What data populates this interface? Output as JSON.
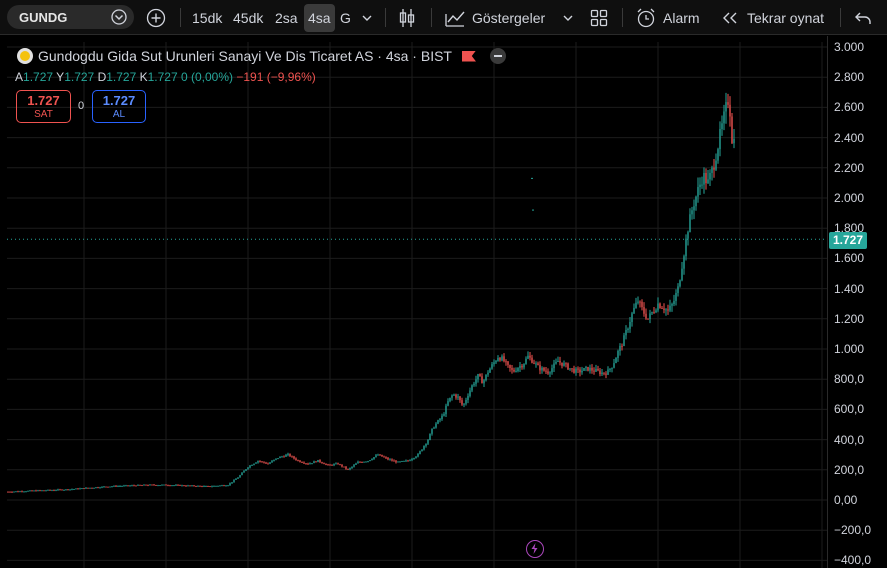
{
  "toolbar": {
    "symbol": "GUNDG",
    "timeframes": [
      "15dk",
      "45dk",
      "2sa",
      "4sa",
      "G"
    ],
    "active_timeframe": "4sa",
    "indicators_label": "Göstergeler",
    "alarm_label": "Alarm",
    "replay_label": "Tekrar oynat"
  },
  "legend": {
    "title": "Gundogdu Gida Sut Urunleri Sanayi Ve Dis Ticaret AS · 4sa · BIST",
    "open_label": "A",
    "open": "1.727",
    "high_label": "Y",
    "high": "1.727",
    "low_label": "D",
    "low": "1.727",
    "close_label": "K",
    "close": "1.727",
    "change": "0 (0,00%)",
    "volume_change": "−191 (−9,96%)"
  },
  "trade": {
    "sell_price": "1.727",
    "sell_label": "SAT",
    "spread": "0",
    "buy_price": "1.727",
    "buy_label": "AL"
  },
  "price_axis": {
    "labels": [
      "3.000",
      "2.800",
      "2.600",
      "2.400",
      "2.200",
      "2.000",
      "1.800",
      "1.600",
      "1.400",
      "1.200",
      "1.000",
      "800,0",
      "600,0",
      "400,0",
      "200,0",
      "0,00",
      "−200,0",
      "−400,0"
    ],
    "last_price_tag": "1.727"
  },
  "colors": {
    "up": "#26a69a",
    "down": "#ef5350",
    "accent": "#2962ff"
  },
  "chart_data": {
    "type": "candlestick",
    "ylim": [
      -400,
      3000
    ],
    "last_price": 1727,
    "close_path": [
      [
        0,
        55
      ],
      [
        20,
        60
      ],
      [
        40,
        65
      ],
      [
        60,
        70
      ],
      [
        80,
        80
      ],
      [
        100,
        90
      ],
      [
        120,
        95
      ],
      [
        140,
        100
      ],
      [
        160,
        100
      ],
      [
        180,
        95
      ],
      [
        200,
        90
      ],
      [
        220,
        100
      ],
      [
        230,
        150
      ],
      [
        240,
        220
      ],
      [
        250,
        260
      ],
      [
        260,
        240
      ],
      [
        270,
        280
      ],
      [
        280,
        300
      ],
      [
        290,
        260
      ],
      [
        300,
        240
      ],
      [
        310,
        260
      ],
      [
        320,
        230
      ],
      [
        330,
        240
      ],
      [
        340,
        200
      ],
      [
        350,
        250
      ],
      [
        360,
        260
      ],
      [
        370,
        300
      ],
      [
        380,
        270
      ],
      [
        390,
        250
      ],
      [
        400,
        260
      ],
      [
        410,
        300
      ],
      [
        415,
        350
      ],
      [
        420,
        400
      ],
      [
        425,
        480
      ],
      [
        430,
        520
      ],
      [
        435,
        560
      ],
      [
        440,
        650
      ],
      [
        445,
        700
      ],
      [
        450,
        680
      ],
      [
        455,
        620
      ],
      [
        460,
        700
      ],
      [
        465,
        770
      ],
      [
        470,
        820
      ],
      [
        475,
        780
      ],
      [
        480,
        850
      ],
      [
        485,
        900
      ],
      [
        490,
        950
      ],
      [
        495,
        930
      ],
      [
        500,
        880
      ],
      [
        505,
        850
      ],
      [
        510,
        880
      ],
      [
        515,
        900
      ],
      [
        520,
        950
      ],
      [
        525,
        920
      ],
      [
        530,
        880
      ],
      [
        535,
        860
      ],
      [
        540,
        850
      ],
      [
        545,
        880
      ],
      [
        550,
        920
      ],
      [
        555,
        900
      ],
      [
        560,
        880
      ],
      [
        565,
        860
      ],
      [
        570,
        850
      ],
      [
        575,
        860
      ],
      [
        580,
        870
      ],
      [
        585,
        860
      ],
      [
        590,
        850
      ],
      [
        595,
        840
      ],
      [
        600,
        850
      ],
      [
        605,
        900
      ],
      [
        610,
        980
      ],
      [
        615,
        1050
      ],
      [
        620,
        1150
      ],
      [
        625,
        1250
      ],
      [
        630,
        1320
      ],
      [
        635,
        1250
      ],
      [
        640,
        1200
      ],
      [
        645,
        1250
      ],
      [
        650,
        1300
      ],
      [
        655,
        1280
      ],
      [
        660,
        1250
      ],
      [
        665,
        1300
      ],
      [
        670,
        1400
      ],
      [
        675,
        1600
      ],
      [
        680,
        1800
      ],
      [
        685,
        1950
      ],
      [
        690,
        2050
      ],
      [
        695,
        2150
      ],
      [
        700,
        2100
      ],
      [
        705,
        2200
      ],
      [
        710,
        2350
      ],
      [
        715,
        2500
      ],
      [
        720,
        2650
      ],
      [
        722,
        2580
      ],
      [
        724,
        2400
      ],
      [
        726,
        2380
      ]
    ]
  }
}
